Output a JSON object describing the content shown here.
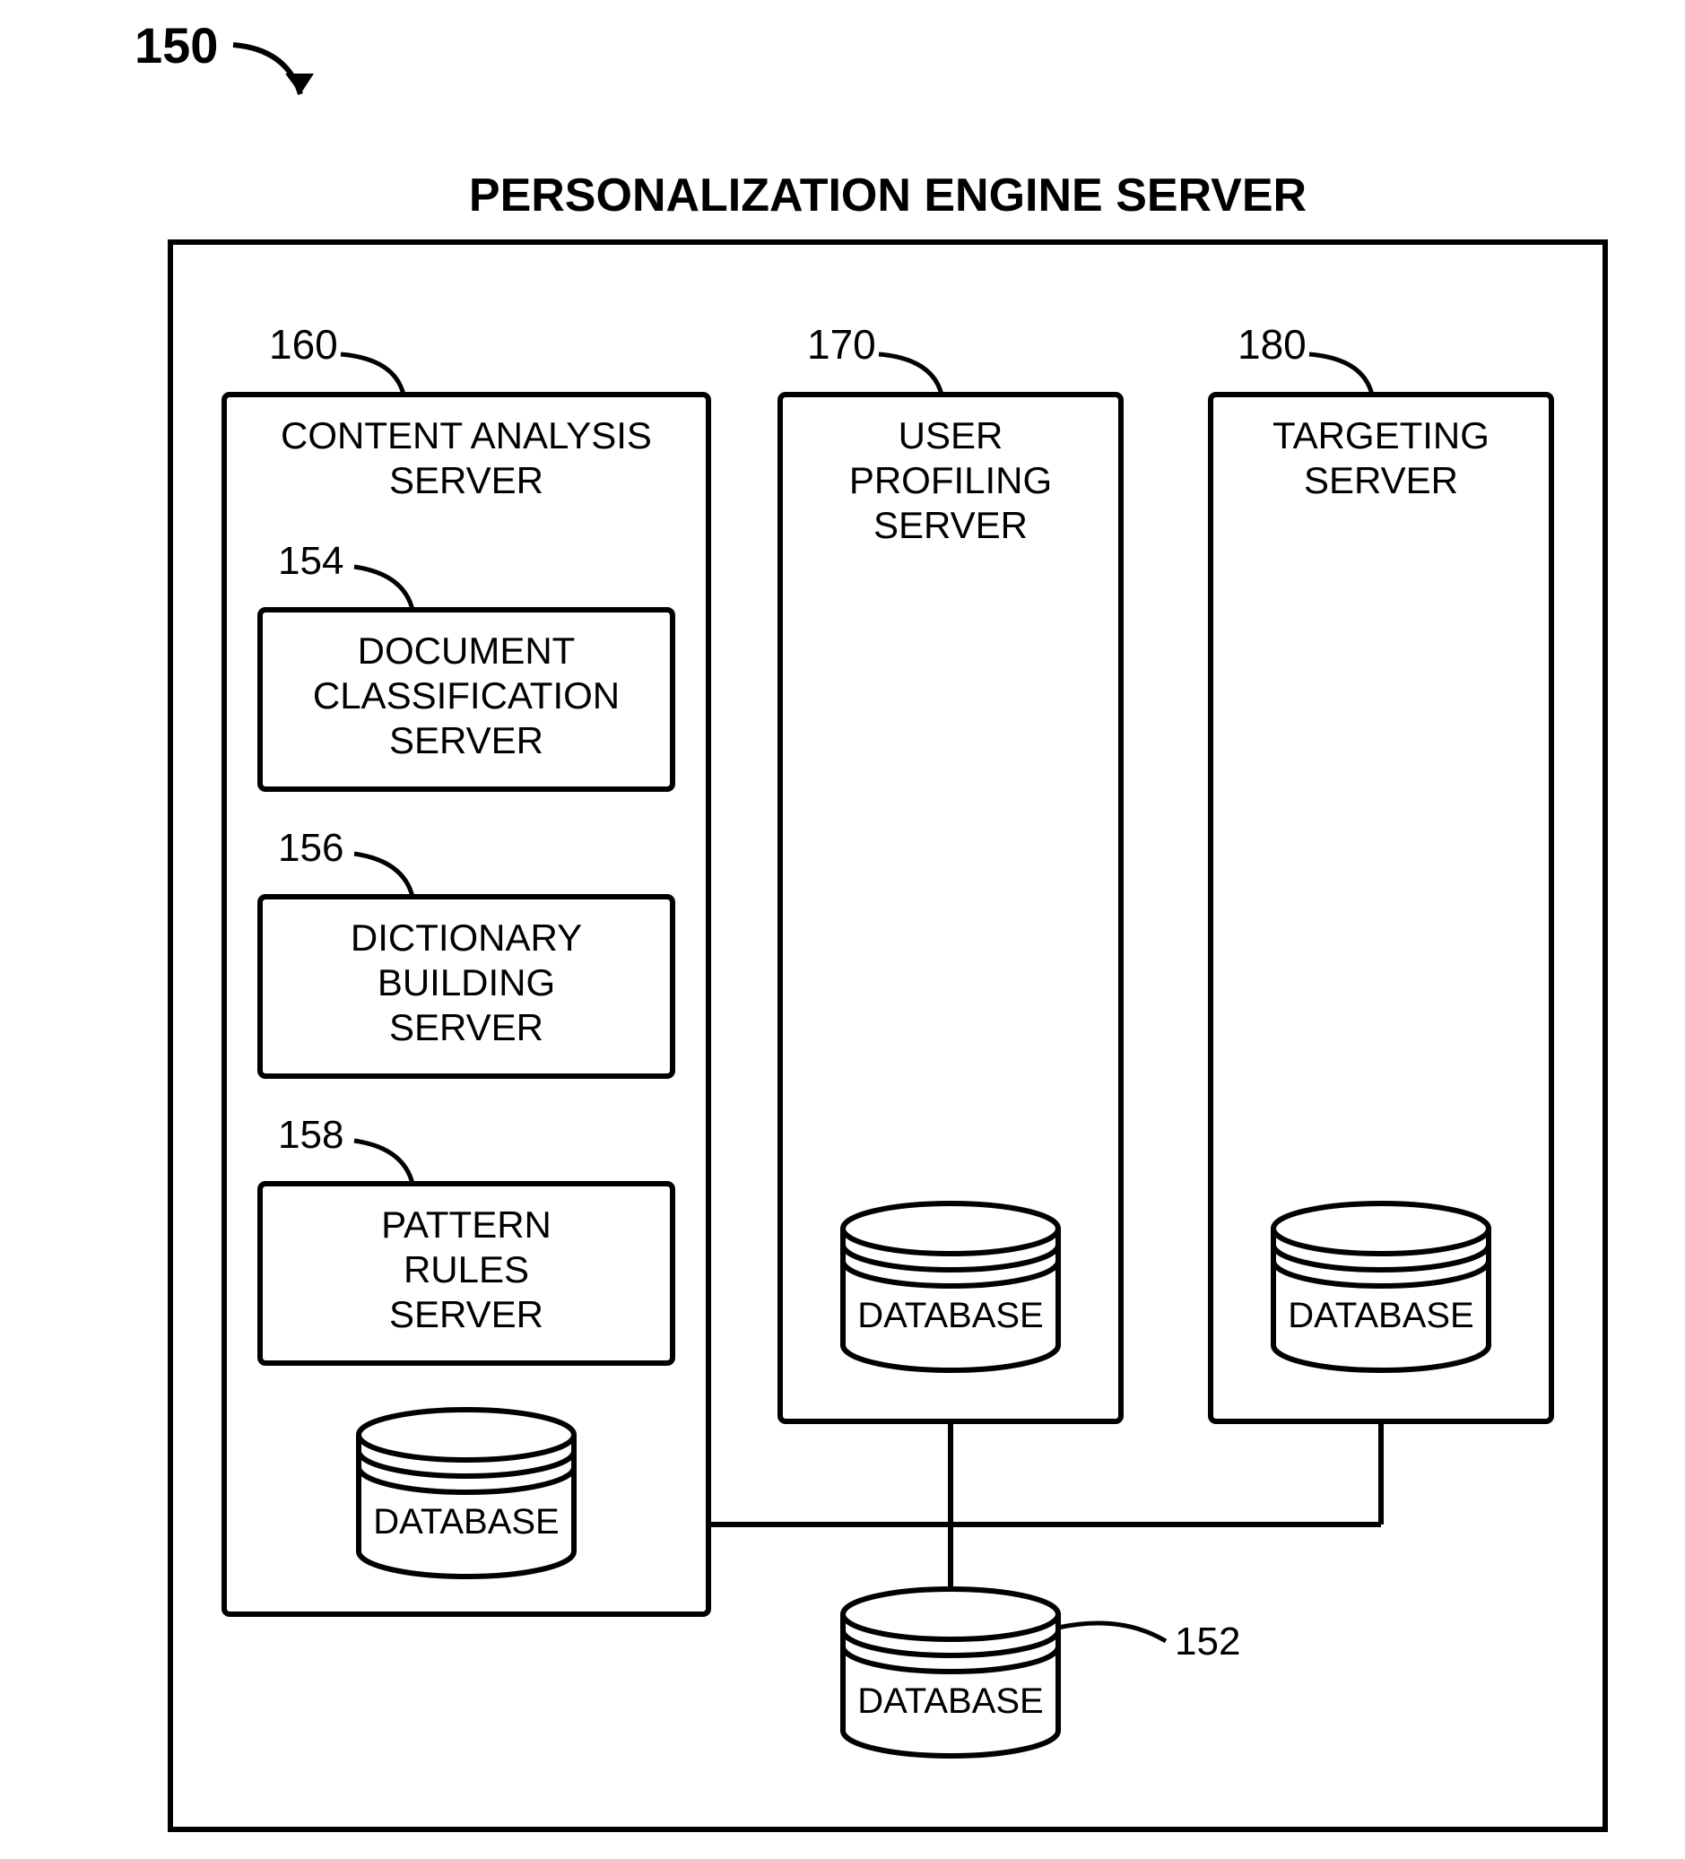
{
  "figure": {
    "ref_main": "150",
    "title": "PERSONALIZATION ENGINE SERVER",
    "bottom_db": {
      "label": "DATABASE",
      "ref": "152"
    },
    "col1": {
      "ref": "160",
      "title_l1": "CONTENT ANALYSIS",
      "title_l2": "SERVER",
      "sub1": {
        "ref": "154",
        "l1": "DOCUMENT",
        "l2": "CLASSIFICATION",
        "l3": "SERVER"
      },
      "sub2": {
        "ref": "156",
        "l1": "DICTIONARY",
        "l2": "BUILDING",
        "l3": "SERVER"
      },
      "sub3": {
        "ref": "158",
        "l1": "PATTERN",
        "l2": "RULES",
        "l3": "SERVER"
      },
      "db": {
        "label": "DATABASE"
      }
    },
    "col2": {
      "ref": "170",
      "title_l1": "USER",
      "title_l2": "PROFILING",
      "title_l3": "SERVER",
      "db": {
        "label": "DATABASE"
      }
    },
    "col3": {
      "ref": "180",
      "title_l1": "TARGETING",
      "title_l2": "SERVER",
      "db": {
        "label": "DATABASE"
      }
    }
  }
}
